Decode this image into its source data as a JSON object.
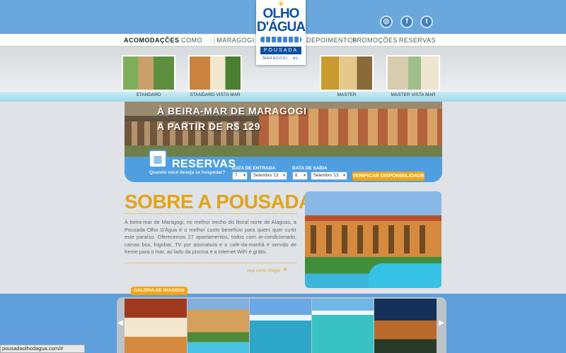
{
  "nav": {
    "items": [
      {
        "label": "ACOMODAÇÕES",
        "active": true
      },
      {
        "label": "COMO CHEGAR"
      },
      {
        "label": "MARAGOGI"
      },
      {
        "label": "DEPOIMENTOS"
      },
      {
        "label": "PROMOÇÕES"
      },
      {
        "label": "RESERVAS"
      }
    ]
  },
  "social": [
    "tripadvisor-icon",
    "facebook-icon",
    "twitter-icon"
  ],
  "logo": {
    "line1": "OLHO",
    "line2": "D'ÁGUA",
    "pousada": "POUSADA",
    "sub": "MARAGOGI · AL"
  },
  "rooms": [
    {
      "label": "STANDARD"
    },
    {
      "label": "STANDARD VISTA MAR"
    },
    {
      "label": "MASTER"
    },
    {
      "label": "MASTER VISTA MAR"
    }
  ],
  "banner": {
    "line1": "À BEIRA-MAR DE MARAGOGI",
    "line2": "A PARTIR DE R$ 129"
  },
  "reservation": {
    "title": "RESERVAS",
    "subtitle": "Quando você deseja se hospedar?",
    "checkin_label": "DATA DE ENTRADA",
    "checkin_day": "7",
    "checkin_month": "Setembro '13",
    "checkout_label": "DATA DE SAÍDA",
    "checkout_day": "8",
    "checkout_month": "Setembro '13",
    "button": "VERIFICAR DISPONIBILIDADE"
  },
  "about": {
    "title": "SOBRE A POUSADA",
    "text": "À beira-mar de Maragogi, no melhor trecho do litoral norte de Alagoas, a Pousada Olho D'Água é o melhor custo benefício para quem quer curtir este paraíso. Oferecemos 27 apartamentos, todos com ar-condicionado, camas box, frigobar, TV por assinatura e o café-da-manhã é servido de frente para o mar, ao lado da piscina e a internet WiFi é grátis.",
    "link": "veja como chegar"
  },
  "gallery": {
    "tab": "GALERIA DE IMAGENS"
  },
  "status": {
    "url": "pousadaolhodagua.com/#"
  },
  "colors": {
    "accent": "#e3a318",
    "blue": "#4f9fe0",
    "brand": "#0f4f9e"
  }
}
